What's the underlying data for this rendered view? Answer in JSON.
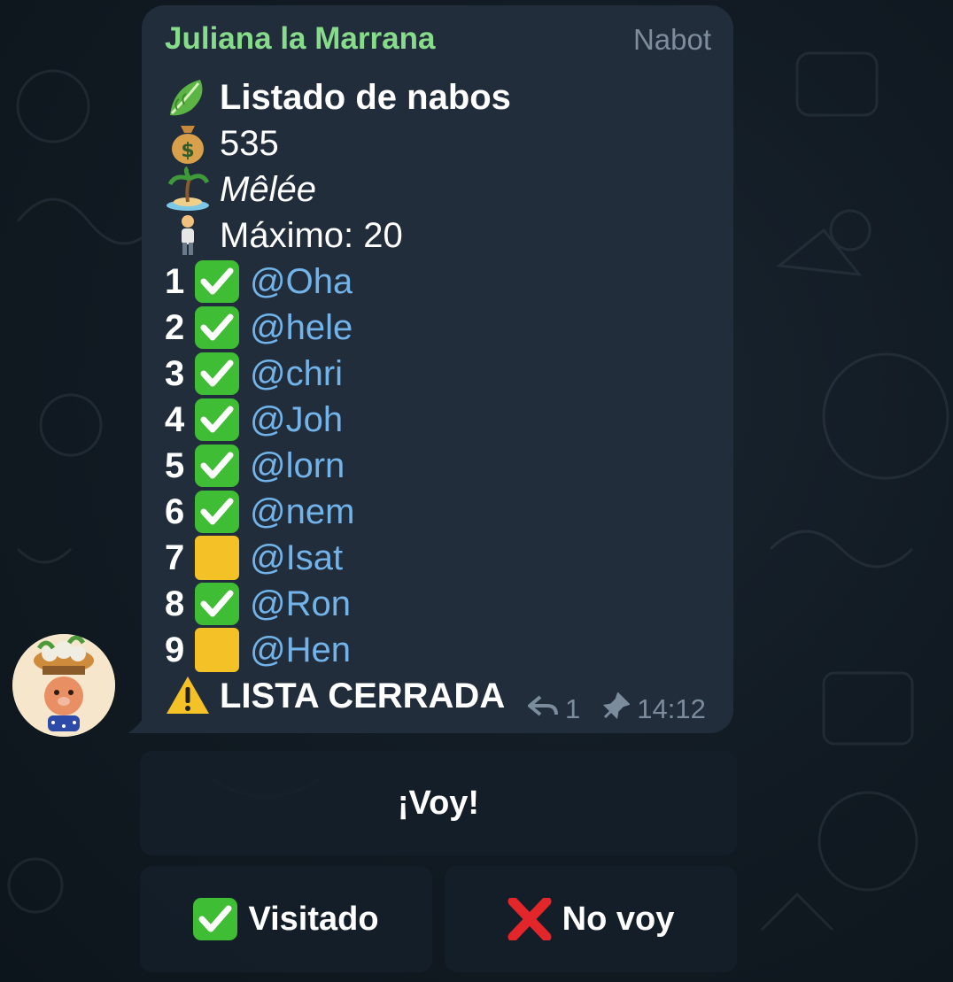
{
  "message": {
    "sender": "Juliana la Marrana",
    "bot_name": "Nabot",
    "title": "Listado de nabos",
    "price": "535",
    "island": "Mêlée",
    "max_label": "Máximo: 20",
    "entries": [
      {
        "num": "1",
        "status": "check",
        "user": "@Oha"
      },
      {
        "num": "2",
        "status": "check",
        "user": "@hele"
      },
      {
        "num": "3",
        "status": "check",
        "user": "@chri"
      },
      {
        "num": "4",
        "status": "check",
        "user": "@Joh"
      },
      {
        "num": "5",
        "status": "check",
        "user": "@lorn"
      },
      {
        "num": "6",
        "status": "check",
        "user": "@nem"
      },
      {
        "num": "7",
        "status": "pending",
        "user": "@Isat"
      },
      {
        "num": "8",
        "status": "check",
        "user": "@Ron"
      },
      {
        "num": "9",
        "status": "pending",
        "user": "@Hen"
      }
    ],
    "closed_label": "LISTA CERRADA",
    "reply_count": "1",
    "time": "14:12"
  },
  "keyboard": {
    "voy": "¡Voy!",
    "visitado": "Visitado",
    "no_voy": "No voy"
  },
  "icons": {
    "title": "lettuce-icon",
    "price": "money-bag-icon",
    "island": "desert-island-icon",
    "max": "person-icon",
    "closed": "warning-icon"
  },
  "colors": {
    "sender": "#87dc8b",
    "mention": "#72b4ea",
    "bubble": "#212d3b",
    "check": "#3fbd34",
    "pending": "#f4c126"
  }
}
